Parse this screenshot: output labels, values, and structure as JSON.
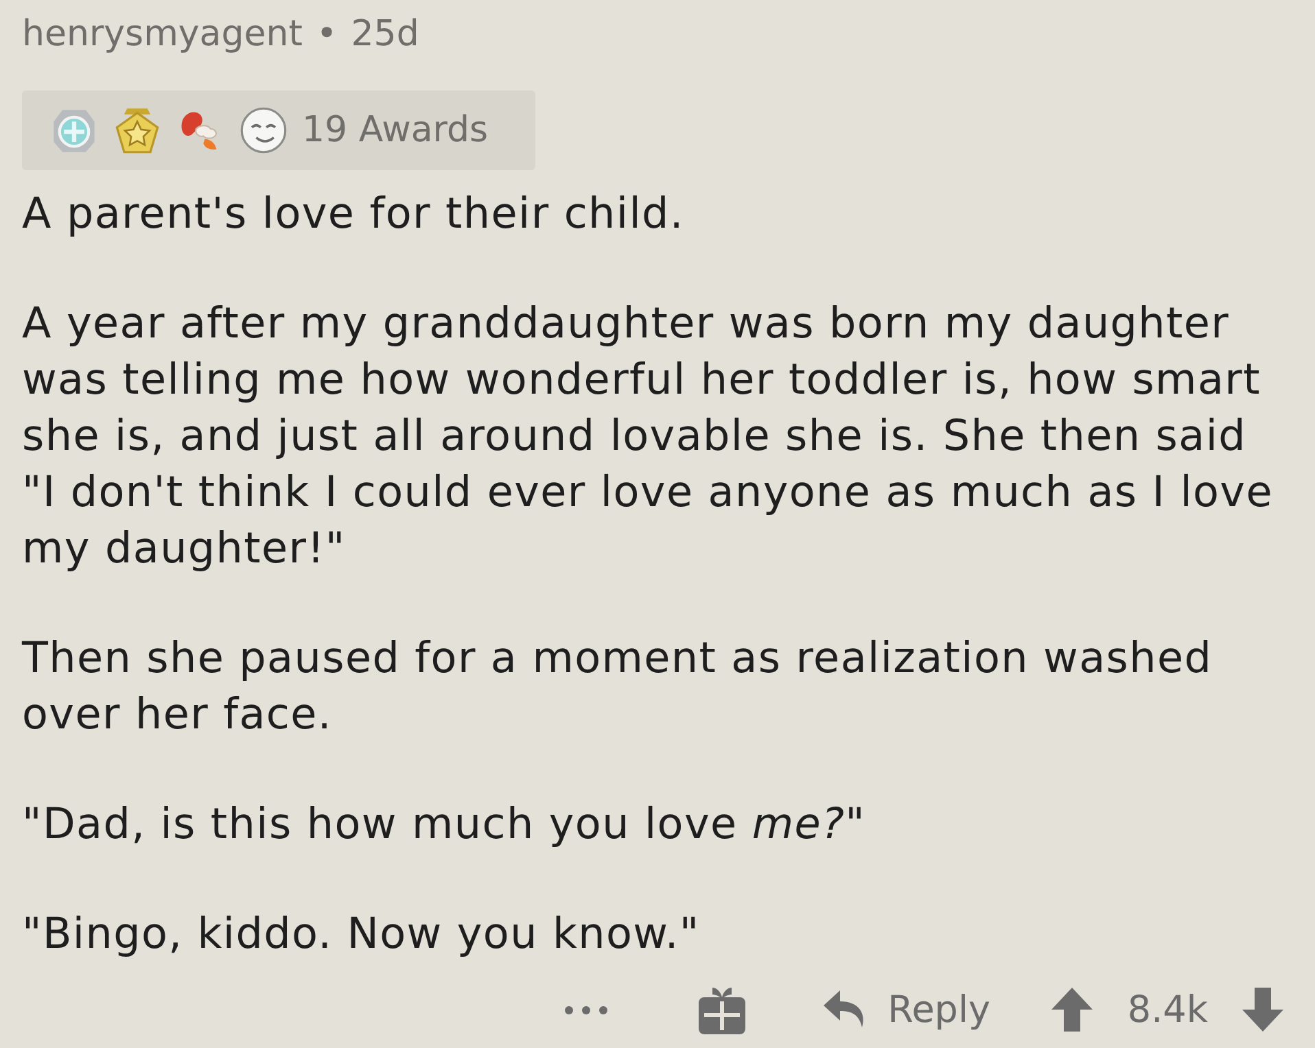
{
  "comment": {
    "author": "henrysmyagent",
    "separator": "•",
    "age": "25d"
  },
  "awards": {
    "count_label": "19 Awards"
  },
  "body": {
    "paragraphs": [
      "A parent's love for their child.",
      "A year after my granddaughter was born my daughter was telling me how wonderful her toddler is, how smart she is, and just all around lovable she is. She then said \"I don't think I could ever love anyone as much as I love my daughter!\"",
      "Then she paused for a moment as realization washed over her face.",
      "\"Dad, is this how much you love *me?*\"",
      "\"Bingo, kiddo. Now you know.\""
    ]
  },
  "actions": {
    "reply_label": "Reply",
    "score": "8.4k"
  }
}
